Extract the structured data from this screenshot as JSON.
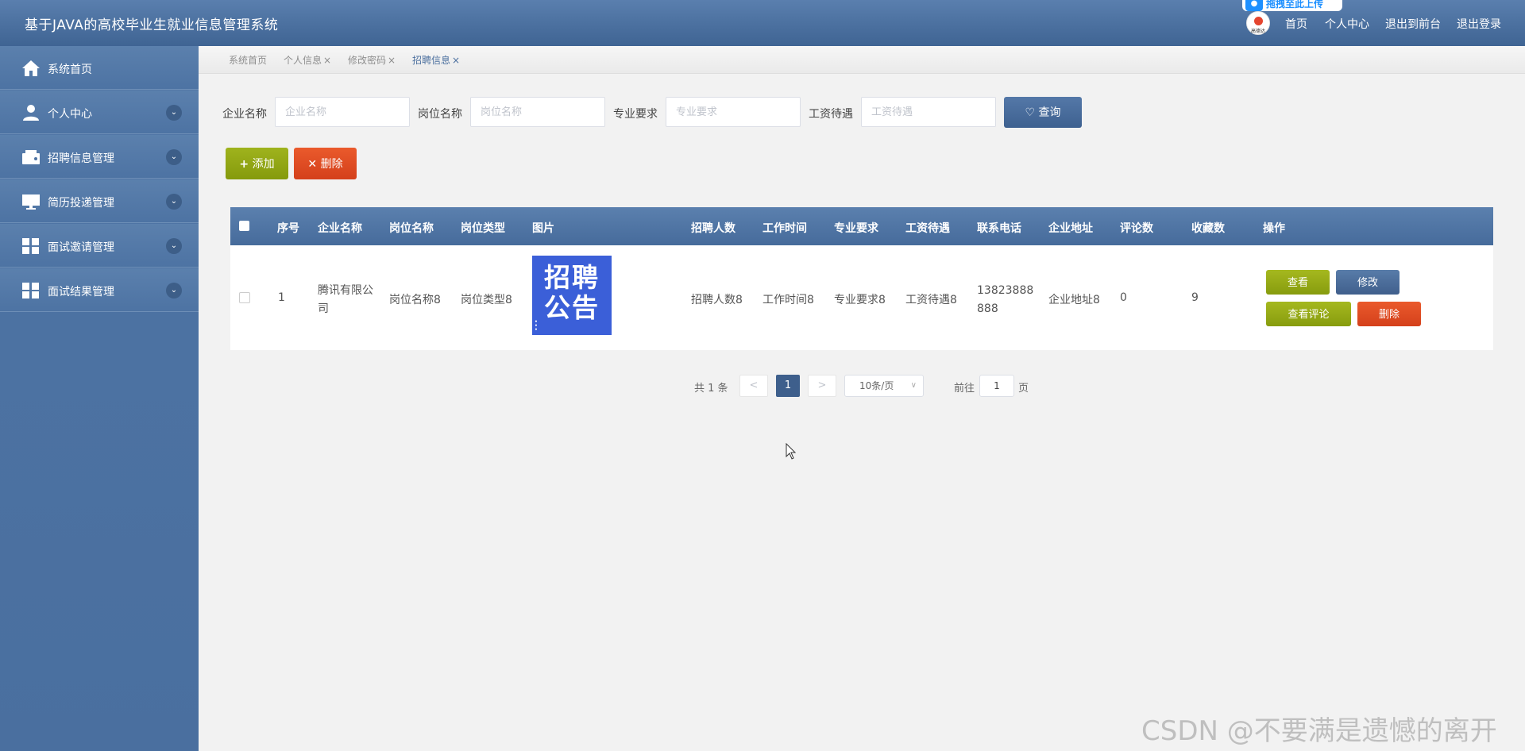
{
  "header": {
    "title": "基于JAVA的高校毕业生就业信息管理系统",
    "badge_text": "拖拽至此上传",
    "avatar_label": "高德达",
    "nav": [
      "首页",
      "个人中心",
      "退出到前台",
      "退出登录"
    ]
  },
  "sidebar": {
    "items": [
      {
        "label": "系统首页",
        "icon": "home-icon"
      },
      {
        "label": "个人中心",
        "icon": "user-icon"
      },
      {
        "label": "招聘信息管理",
        "icon": "wallet-icon"
      },
      {
        "label": "简历投递管理",
        "icon": "monitor-icon"
      },
      {
        "label": "面试邀请管理",
        "icon": "grid-icon"
      },
      {
        "label": "面试结果管理",
        "icon": "grid-icon"
      }
    ]
  },
  "tabs": [
    {
      "label": "系统首页",
      "closable": false
    },
    {
      "label": "个人信息",
      "closable": true
    },
    {
      "label": "修改密码",
      "closable": true
    },
    {
      "label": "招聘信息",
      "closable": true,
      "active": true
    }
  ],
  "search": {
    "fields": [
      {
        "label": "企业名称",
        "placeholder": "企业名称"
      },
      {
        "label": "岗位名称",
        "placeholder": "岗位名称"
      },
      {
        "label": "专业要求",
        "placeholder": "专业要求"
      },
      {
        "label": "工资待遇",
        "placeholder": "工资待遇"
      }
    ],
    "query_label": "查询"
  },
  "actions": {
    "add_label": "添加",
    "delete_label": "删除"
  },
  "table": {
    "columns": [
      "序号",
      "企业名称",
      "岗位名称",
      "岗位类型",
      "图片",
      "招聘人数",
      "工作时间",
      "专业要求",
      "工资待遇",
      "联系电话",
      "企业地址",
      "评论数",
      "收藏数",
      "操作"
    ],
    "rows": [
      {
        "index": "1",
        "company": "腾讯有限公司",
        "position": "岗位名称8",
        "type": "岗位类型8",
        "image_text": "招聘公告",
        "headcount": "招聘人数8",
        "work_time": "工作时间8",
        "major": "专业要求8",
        "salary": "工资待遇8",
        "phone": "13823888888",
        "address": "企业地址8",
        "comments": "0",
        "favorites": "9"
      }
    ],
    "row_actions": {
      "view": "查看",
      "edit": "修改",
      "view_comments": "查看评论",
      "delete": "删除"
    }
  },
  "pagination": {
    "total_text": "共 1 条",
    "prev": "<",
    "current": "1",
    "next": ">",
    "page_size": "10条/页",
    "goto_label": "前往",
    "goto_value": "1",
    "page_unit": "页"
  },
  "watermark": "CSDN @不要满是遗憾的离开",
  "colors": {
    "header": "#4a6f9f",
    "accent_green": "#94a81a",
    "accent_red": "#e04a22",
    "accent_blue": "#466b9b"
  }
}
